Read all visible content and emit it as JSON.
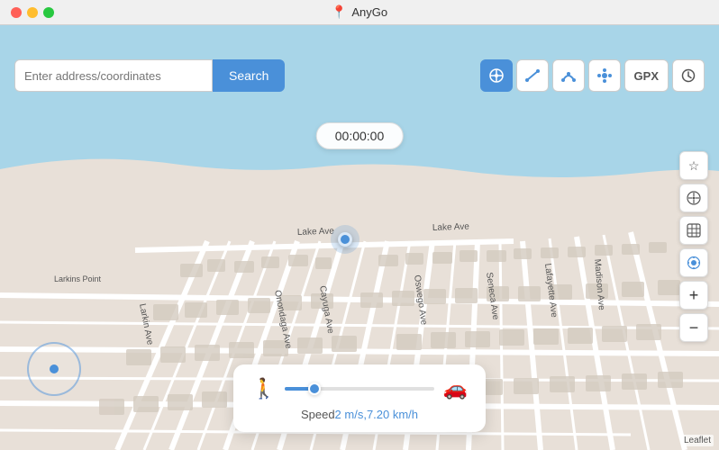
{
  "titlebar": {
    "title": "AnyGo",
    "icon": "📍"
  },
  "toolbar": {
    "search_placeholder": "Enter address/coordinates",
    "search_value": "",
    "search_button_label": "Search",
    "tools": [
      {
        "id": "crosshair",
        "icon": "⊕",
        "label": "Teleport Mode",
        "active": true
      },
      {
        "id": "route1",
        "icon": "↗",
        "label": "One-stop Route",
        "active": false
      },
      {
        "id": "route2",
        "icon": "↝",
        "label": "Multi-stop Route",
        "active": false
      },
      {
        "id": "joystick",
        "icon": "✦",
        "label": "Joystick Mode",
        "active": false
      },
      {
        "id": "gpx",
        "icon": "GPX",
        "label": "GPX Import",
        "active": false
      },
      {
        "id": "history",
        "icon": "⏱",
        "label": "History",
        "active": false
      }
    ]
  },
  "map": {
    "timer": "00:00:00",
    "road_labels": [
      "Lake Ave",
      "Lake Ave",
      "Madison Ave",
      "Lafayette Ave",
      "Seneca Ave",
      "Onondaga Ave",
      "Cayuga Ave",
      "Oswego Ave",
      "Larkin Ave",
      "Larkins Point"
    ],
    "leaflet_label": "Leaflet"
  },
  "speed_panel": {
    "walk_icon": "🚶",
    "car_icon": "🚗",
    "speed_text": "Speed ",
    "speed_value": "2 m/s,7.20 km/h",
    "slider_percent": 20
  },
  "map_controls": [
    {
      "id": "star",
      "icon": "☆",
      "label": "Favorites"
    },
    {
      "id": "compass",
      "icon": "⊙",
      "label": "Compass"
    },
    {
      "id": "map-type",
      "icon": "⊞",
      "label": "Map Type"
    },
    {
      "id": "location",
      "icon": "◎",
      "label": "My Location"
    },
    {
      "id": "zoom-in",
      "icon": "+",
      "label": "Zoom In"
    },
    {
      "id": "zoom-out",
      "icon": "−",
      "label": "Zoom Out"
    }
  ]
}
